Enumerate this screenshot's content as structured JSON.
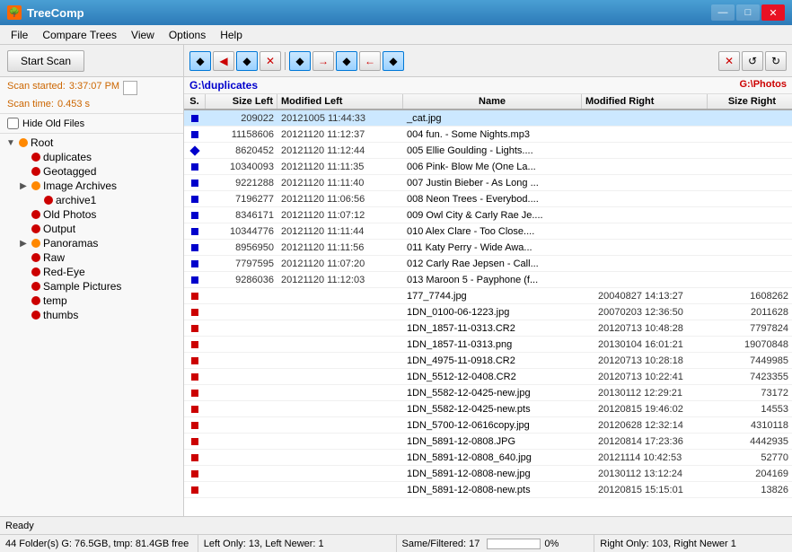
{
  "titleBar": {
    "title": "TreeComp",
    "icon": "🌳",
    "minimize": "—",
    "maximize": "□",
    "close": "✕"
  },
  "menuBar": {
    "items": [
      "File",
      "Compare Trees",
      "View",
      "Options",
      "Help"
    ]
  },
  "toolbar": {
    "startScan": "Start Scan"
  },
  "scanInfo": {
    "startedLabel": "Scan started:",
    "startedTime": "3:37:07 PM",
    "scanTimeLabel": "Scan time:",
    "scanTime": "0.453 s"
  },
  "hideOldFiles": "Hide Old Files",
  "tree": {
    "items": [
      {
        "label": "Root",
        "level": 0,
        "dot": "orange",
        "expand": "▼"
      },
      {
        "label": "duplicates",
        "level": 1,
        "dot": "red",
        "expand": ""
      },
      {
        "label": "Geotagged",
        "level": 1,
        "dot": "red",
        "expand": ""
      },
      {
        "label": "Image Archives",
        "level": 1,
        "dot": "orange",
        "expand": "▶"
      },
      {
        "label": "archive1",
        "level": 2,
        "dot": "red",
        "expand": ""
      },
      {
        "label": "Old Photos",
        "level": 1,
        "dot": "red",
        "expand": ""
      },
      {
        "label": "Output",
        "level": 1,
        "dot": "red",
        "expand": ""
      },
      {
        "label": "Panoramas",
        "level": 1,
        "dot": "orange",
        "expand": "▶"
      },
      {
        "label": "Raw",
        "level": 1,
        "dot": "red",
        "expand": ""
      },
      {
        "label": "Red-Eye",
        "level": 1,
        "dot": "red",
        "expand": ""
      },
      {
        "label": "Sample Pictures",
        "level": 1,
        "dot": "red",
        "expand": ""
      },
      {
        "label": "temp",
        "level": 1,
        "dot": "red",
        "expand": ""
      },
      {
        "label": "thumbs",
        "level": 1,
        "dot": "red",
        "expand": ""
      }
    ]
  },
  "rightPanel": {
    "leftPath": "G:\\duplicates",
    "rightPath": "G:\\Photos",
    "toolbar": {
      "btn1": "◆",
      "btn2": "◀",
      "btn3": "◆",
      "btn4": "✕",
      "btn5": "→",
      "btn6": "◆",
      "btn7": "←",
      "btn8": "◆",
      "btn9": "✕",
      "btn10": "↺",
      "btn11": "↻"
    },
    "columns": {
      "s": "S.",
      "sizeLeft": "Size Left",
      "modLeft": "Modified Left",
      "name": "Name",
      "modRight": "Modified Right",
      "sizeRight": "Size Right"
    },
    "rows": [
      {
        "dot": "blue",
        "dotType": "square",
        "sizeLeft": "209022",
        "modLeft": "20121005 11:44:33",
        "name": "_cat.jpg",
        "modRight": "",
        "sizeRight": "",
        "selected": true
      },
      {
        "dot": "blue",
        "dotType": "square",
        "sizeLeft": "11158606",
        "modLeft": "20121120 11:12:37",
        "name": "004 fun. - Some Nights.mp3",
        "modRight": "",
        "sizeRight": ""
      },
      {
        "dot": "blue",
        "dotType": "diamond",
        "sizeLeft": "8620452",
        "modLeft": "20121120 11:12:44",
        "name": "005 Ellie Goulding - Lights....",
        "modRight": "",
        "sizeRight": ""
      },
      {
        "dot": "blue",
        "dotType": "square",
        "sizeLeft": "10340093",
        "modLeft": "20121120 11:11:35",
        "name": "006 Pink- Blow Me (One La...",
        "modRight": "",
        "sizeRight": ""
      },
      {
        "dot": "blue",
        "dotType": "square",
        "sizeLeft": "9221288",
        "modLeft": "20121120 11:11:40",
        "name": "007 Justin Bieber - As Long ...",
        "modRight": "",
        "sizeRight": ""
      },
      {
        "dot": "blue",
        "dotType": "square",
        "sizeLeft": "7196277",
        "modLeft": "20121120 11:06:56",
        "name": "008 Neon Trees - Everybod....",
        "modRight": "",
        "sizeRight": ""
      },
      {
        "dot": "blue",
        "dotType": "square",
        "sizeLeft": "8346171",
        "modLeft": "20121120 11:07:12",
        "name": "009 Owl City & Carly Rae Je....",
        "modRight": "",
        "sizeRight": ""
      },
      {
        "dot": "blue",
        "dotType": "square",
        "sizeLeft": "10344776",
        "modLeft": "20121120 11:11:44",
        "name": "010 Alex Clare - Too Close....",
        "modRight": "",
        "sizeRight": ""
      },
      {
        "dot": "blue",
        "dotType": "square",
        "sizeLeft": "8956950",
        "modLeft": "20121120 11:11:56",
        "name": "011 Katy Perry - Wide Awa...",
        "modRight": "",
        "sizeRight": ""
      },
      {
        "dot": "blue",
        "dotType": "square",
        "sizeLeft": "7797595",
        "modLeft": "20121120 11:07:20",
        "name": "012 Carly Rae Jepsen - Call...",
        "modRight": "",
        "sizeRight": ""
      },
      {
        "dot": "blue",
        "dotType": "square",
        "sizeLeft": "9286036",
        "modLeft": "20121120 11:12:03",
        "name": "013 Maroon 5 - Payphone (f...",
        "modRight": "",
        "sizeRight": ""
      },
      {
        "dot": "red",
        "dotType": "square",
        "sizeLeft": "",
        "modLeft": "",
        "name": "177_7744.jpg",
        "modRight": "20040827 14:13:27",
        "sizeRight": "1608262"
      },
      {
        "dot": "red",
        "dotType": "square",
        "sizeLeft": "",
        "modLeft": "",
        "name": "1DN_0100-06-1223.jpg",
        "modRight": "20070203 12:36:50",
        "sizeRight": "2011628"
      },
      {
        "dot": "red",
        "dotType": "square",
        "sizeLeft": "",
        "modLeft": "",
        "name": "1DN_1857-11-0313.CR2",
        "modRight": "20120713 10:48:28",
        "sizeRight": "7797824"
      },
      {
        "dot": "red",
        "dotType": "square",
        "sizeLeft": "",
        "modLeft": "",
        "name": "1DN_1857-11-0313.png",
        "modRight": "20130104 16:01:21",
        "sizeRight": "19070848"
      },
      {
        "dot": "red",
        "dotType": "square",
        "sizeLeft": "",
        "modLeft": "",
        "name": "1DN_4975-11-0918.CR2",
        "modRight": "20120713 10:28:18",
        "sizeRight": "7449985"
      },
      {
        "dot": "red",
        "dotType": "square",
        "sizeLeft": "",
        "modLeft": "",
        "name": "1DN_5512-12-0408.CR2",
        "modRight": "20120713 10:22:41",
        "sizeRight": "7423355"
      },
      {
        "dot": "red",
        "dotType": "square",
        "sizeLeft": "",
        "modLeft": "",
        "name": "1DN_5582-12-0425-new.jpg",
        "modRight": "20130112 12:29:21",
        "sizeRight": "73172"
      },
      {
        "dot": "red",
        "dotType": "square",
        "sizeLeft": "",
        "modLeft": "",
        "name": "1DN_5582-12-0425-new.pts",
        "modRight": "20120815 19:46:02",
        "sizeRight": "14553"
      },
      {
        "dot": "red",
        "dotType": "square",
        "sizeLeft": "",
        "modLeft": "",
        "name": "1DN_5700-12-0616copy.jpg",
        "modRight": "20120628 12:32:14",
        "sizeRight": "4310118"
      },
      {
        "dot": "red",
        "dotType": "square",
        "sizeLeft": "",
        "modLeft": "",
        "name": "1DN_5891-12-0808.JPG",
        "modRight": "20120814 17:23:36",
        "sizeRight": "4442935"
      },
      {
        "dot": "red",
        "dotType": "square",
        "sizeLeft": "",
        "modLeft": "",
        "name": "1DN_5891-12-0808_640.jpg",
        "modRight": "20121114 10:42:53",
        "sizeRight": "52770"
      },
      {
        "dot": "red",
        "dotType": "square",
        "sizeLeft": "",
        "modLeft": "",
        "name": "1DN_5891-12-0808-new.jpg",
        "modRight": "20130112 13:12:24",
        "sizeRight": "204169"
      },
      {
        "dot": "red",
        "dotType": "square",
        "sizeLeft": "",
        "modLeft": "",
        "name": "1DN_5891-12-0808-new.pts",
        "modRight": "20120815 15:15:01",
        "sizeRight": "13826"
      }
    ]
  },
  "statusBar": {
    "ready": "Ready",
    "bottom": {
      "left": "44 Folder(s) G: 76.5GB, tmp: 81.4GB free",
      "leftOnly": "Left Only: 13, Left Newer: 1",
      "sameFiltered": "Same/Filtered: 17",
      "rightOnly": "Right Only: 103, Right Newer 1",
      "progress": "0%"
    }
  }
}
